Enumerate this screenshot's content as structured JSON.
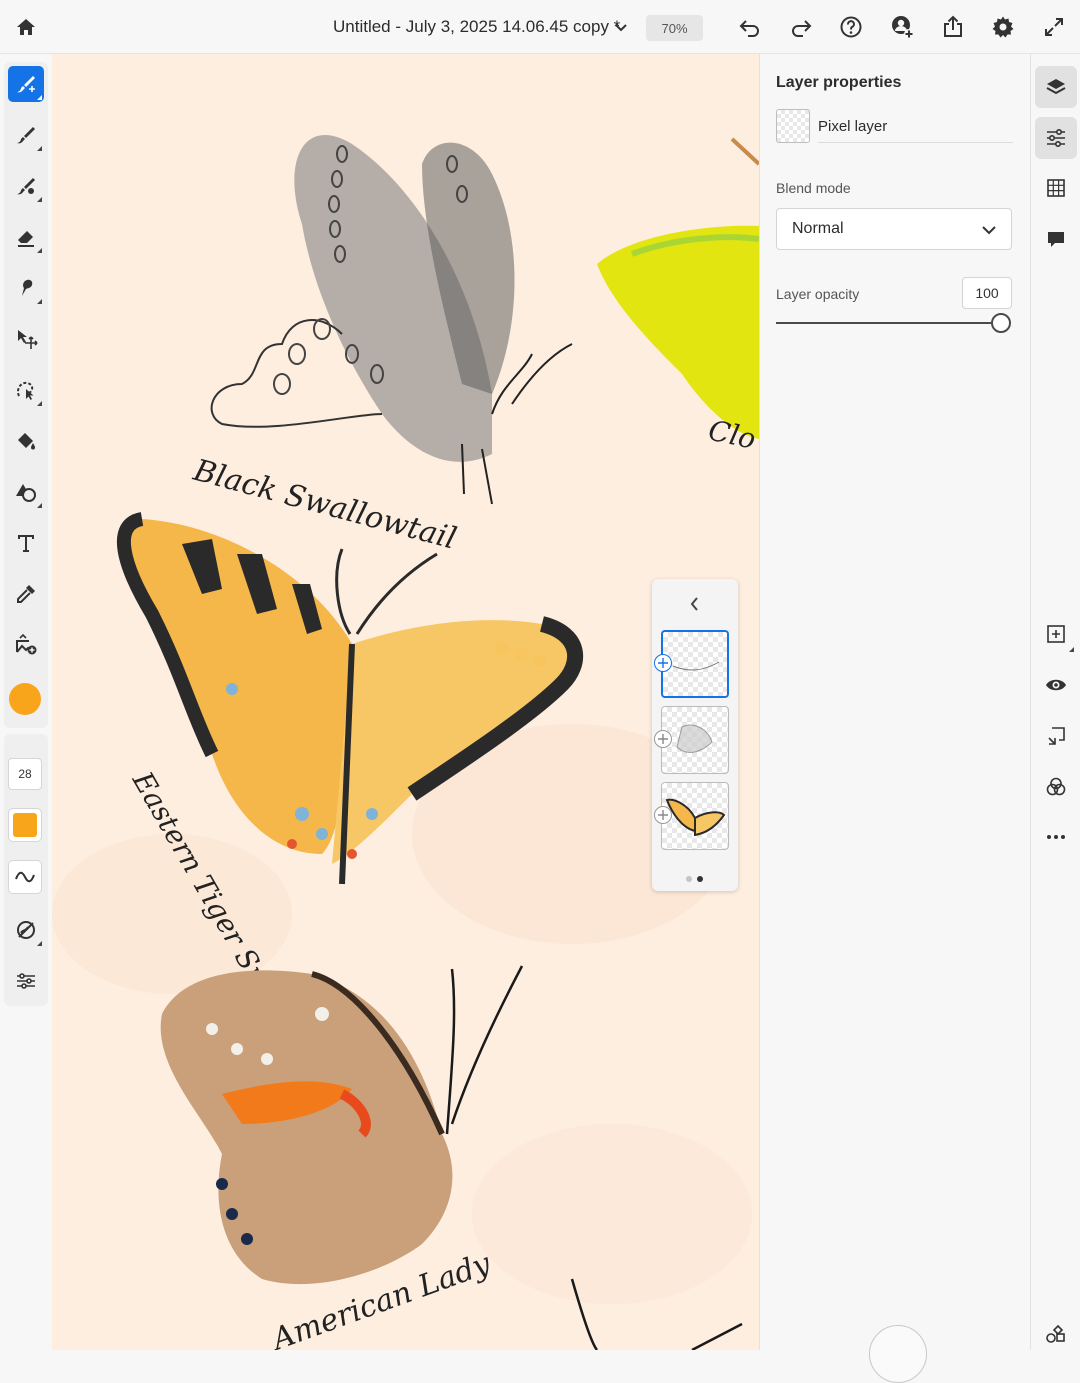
{
  "topbar": {
    "document_title": "Untitled - July 3, 2025 14.06.45 copy *",
    "zoom": "70%",
    "icons": [
      "home-icon",
      "chevron-down-icon",
      "undo-icon",
      "redo-icon",
      "help-icon",
      "invite-user-icon",
      "share-icon",
      "settings-icon",
      "fullscreen-icon"
    ]
  },
  "toolbar": {
    "tools": [
      "brush-select-tool",
      "brush-tool",
      "fill-brush-tool",
      "eraser-tool",
      "smudge-tool",
      "move-tool",
      "lasso-tool",
      "paint-bucket-tool",
      "shape-tool",
      "text-tool",
      "eyedropper-tool",
      "image-add-tool"
    ],
    "active_tool": "brush-select-tool",
    "brush_size": "28",
    "color": "#f9a51b"
  },
  "canvas": {
    "labels": {
      "black_swallowtail": "Black Swallowtail",
      "eastern_tiger": "Eastern Tiger Swallowtail",
      "american_lady": "American Lady",
      "clouded": "Clo"
    }
  },
  "layers_strip": {
    "thumbnails": [
      "text-layer",
      "sketch-layer",
      "butterfly-layer"
    ],
    "selected_index": 0,
    "pages": 2,
    "current_page": 1
  },
  "properties": {
    "title": "Layer properties",
    "layer_type": "Pixel layer",
    "blend_mode_label": "Blend mode",
    "blend_mode": "Normal",
    "opacity_label": "Layer opacity",
    "opacity": "100"
  },
  "rail": {
    "icons": [
      "layers-icon",
      "adjustments-icon",
      "grid-icon",
      "comment-icon",
      "add-layer-icon",
      "visibility-icon",
      "merge-down-icon",
      "blend-icon",
      "more-icon",
      "plugins-icon"
    ],
    "active": "adjustments-icon"
  },
  "colors": {
    "accent": "#1473e6",
    "canvas_bg": "#fdeee0",
    "brush": "#f9a51b"
  }
}
